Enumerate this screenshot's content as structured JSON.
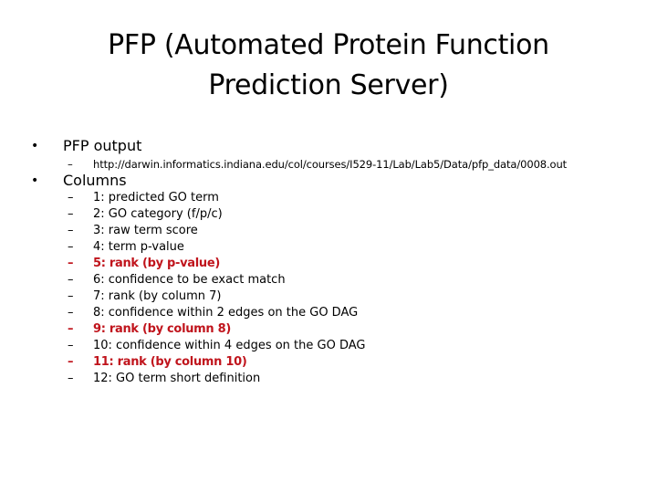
{
  "slide": {
    "title": "PFP (Automated Protein Function Prediction Server)",
    "bullet_glyph": "•",
    "dash_glyph": "–",
    "accent_color": "#c0141c",
    "bullets": [
      {
        "label": "PFP output",
        "subitems": [
          {
            "text": "http://darwin.informatics.indiana.edu/col/courses/I529-11/Lab/Lab5/Data/pfp_data/0008.out",
            "highlight": false
          }
        ]
      },
      {
        "label": "Columns",
        "subitems": [
          {
            "text": "1: predicted GO term",
            "highlight": false
          },
          {
            "text": "2: GO category (f/p/c)",
            "highlight": false
          },
          {
            "text": "3: raw term score",
            "highlight": false
          },
          {
            "text": "4: term p-value",
            "highlight": false
          },
          {
            "text": "5: rank (by p-value)",
            "highlight": true
          },
          {
            "text": "6: confidence to be exact match",
            "highlight": false
          },
          {
            "text": "7: rank (by column 7)",
            "highlight": false
          },
          {
            "text": "8: confidence within 2 edges on the GO DAG",
            "highlight": false
          },
          {
            "text": "9: rank (by column 8)",
            "highlight": true
          },
          {
            "text": "10: confidence within 4 edges on the GO DAG",
            "highlight": false
          },
          {
            "text": "11: rank (by column 10)",
            "highlight": true
          },
          {
            "text": "12: GO term short definition",
            "highlight": false
          }
        ]
      }
    ]
  }
}
